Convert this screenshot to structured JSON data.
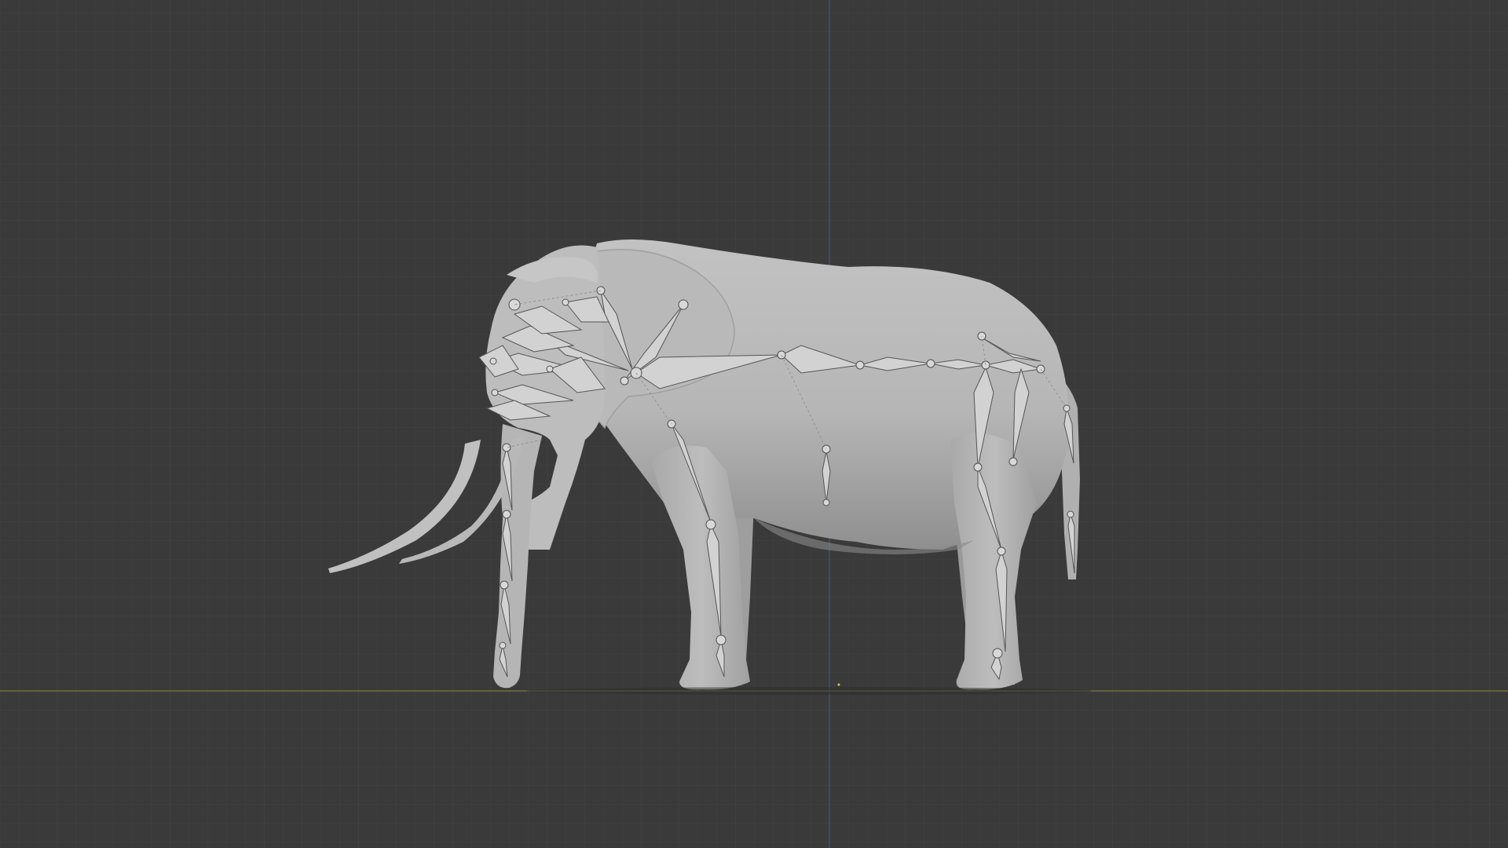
{
  "viewport": {
    "background_color": "#3a3a3a",
    "grid_minor_color": "#424242",
    "grid_major_color": "#474747",
    "x_axis_color": "#7b7b3c",
    "y_axis_color": "#3c5a7b",
    "mesh_color": "#b4b4b4",
    "mesh_shadow_color": "#8c8c8c",
    "armature_color": "#d0d0d0",
    "armature_outline_color": "#5a5a5a",
    "origin_marker_color": "#e0c040"
  },
  "scene": {
    "object": "elephant-mesh",
    "armature": "elephant-rig",
    "shading": "solid"
  }
}
